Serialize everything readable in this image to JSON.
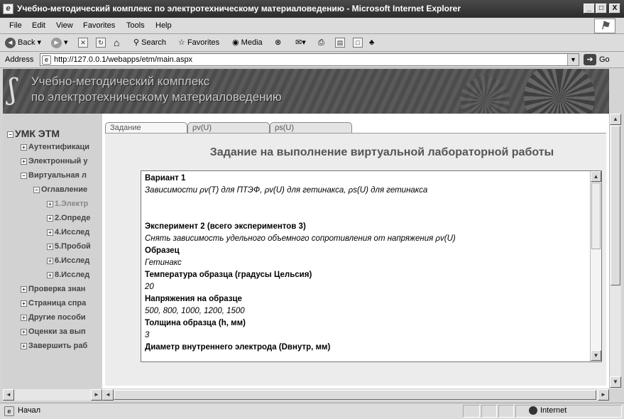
{
  "window": {
    "title": "Учебно-методический комплекс по электротехническому материаловедению - Microsoft Internet Explorer",
    "minimize": "_",
    "maximize": "□",
    "close": "X"
  },
  "menu": {
    "items": [
      {
        "label": "File"
      },
      {
        "label": "Edit"
      },
      {
        "label": "View"
      },
      {
        "label": "Favorites"
      },
      {
        "label": "Tools"
      },
      {
        "label": "Help"
      }
    ]
  },
  "toolbar": {
    "back": "Back",
    "search": "Search",
    "favorites": "Favorites",
    "media": "Media"
  },
  "address": {
    "label": "Address",
    "url": "http://127.0.0.1/webapps/etm/main.aspx",
    "go": "Go"
  },
  "banner": {
    "line1": "Учебно-методический комплекс",
    "line2": "по электротехническому материаловедению"
  },
  "tree": {
    "root": "УМК ЭТМ",
    "items": [
      {
        "label": "Аутентификаци",
        "sign": "+"
      },
      {
        "label": "Электронный у",
        "sign": "+"
      },
      {
        "label": "Виртуальная л",
        "sign": "−"
      },
      {
        "label": "Оглавление",
        "sign": "−"
      },
      {
        "label": "1.Электр",
        "sign": "+"
      },
      {
        "label": "2.Опреде",
        "sign": "+"
      },
      {
        "label": "4.Исслед",
        "sign": "+"
      },
      {
        "label": "5.Пробой",
        "sign": "+"
      },
      {
        "label": "6.Исслед",
        "sign": "+"
      },
      {
        "label": "8.Исслед",
        "sign": "+"
      },
      {
        "label": "Проверка знан",
        "sign": "+"
      },
      {
        "label": "Страница спра",
        "sign": "+"
      },
      {
        "label": "Другие пособи",
        "sign": "+"
      },
      {
        "label": "Оценки за вып",
        "sign": "+"
      },
      {
        "label": "Завершить раб",
        "sign": "+"
      }
    ]
  },
  "tabs": [
    {
      "label": "Задание"
    },
    {
      "label": "ρv(U)"
    },
    {
      "label": "ρs(U)"
    }
  ],
  "assignment": {
    "heading": "Задание на выполнение виртуальной лабораторной работы",
    "variant_title": "Вариант 1",
    "variant_text": "Зависимости ρv(T) для ПТЭФ, ρv(U) для гетинакса, ρs(U) для гетинакса",
    "experiment_title": "Эксперимент 2 (всего экспериментов 3)",
    "experiment_text": "Снять зависимость удельного объемного сопротивления от напряжения ρv(U)",
    "sample_title": "Образец",
    "sample_value": "Гетинакс",
    "temp_title": "Температура образца (градусы Цельсия)",
    "temp_value": "20",
    "voltage_title": "Напряжения на образце",
    "voltage_value": "500, 800, 1000, 1200, 1500",
    "thickness_title": "Толщина образца (h, мм)",
    "thickness_value": "3",
    "diameter_title": "Диаметр внутреннего электрода (Dвнутр, мм)"
  },
  "status": {
    "text": "Начал",
    "zone": "Internet"
  }
}
